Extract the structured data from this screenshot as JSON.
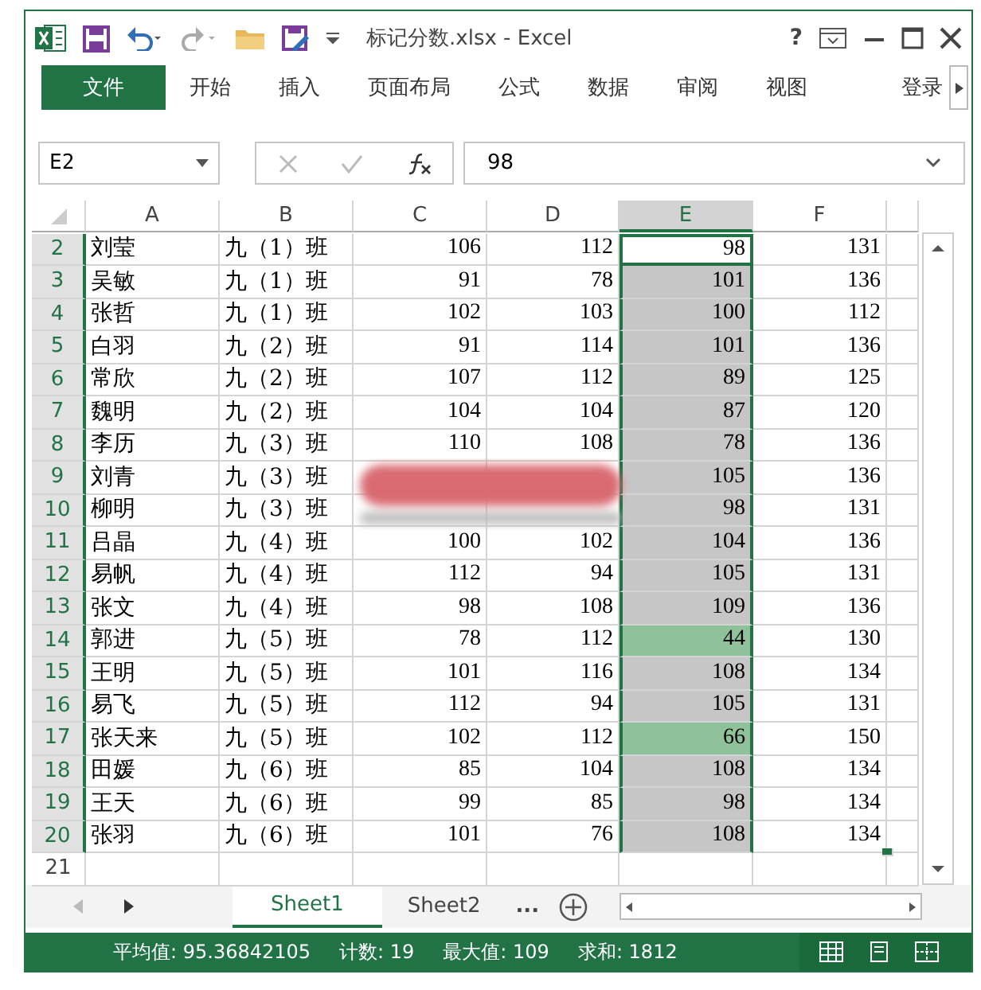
{
  "window": {
    "title": "标记分数.xlsx - Excel",
    "help": "?"
  },
  "ribbon_tabs": [
    {
      "label": "文件",
      "kind": "file"
    },
    {
      "label": "开始",
      "kind": "tab"
    },
    {
      "label": "插入",
      "kind": "tab"
    },
    {
      "label": "页面布局",
      "kind": "tab"
    },
    {
      "label": "公式",
      "kind": "tab"
    },
    {
      "label": "数据",
      "kind": "tab"
    },
    {
      "label": "审阅",
      "kind": "tab"
    },
    {
      "label": "视图",
      "kind": "tab"
    },
    {
      "label": "登录",
      "kind": "account"
    }
  ],
  "name_box": {
    "value": "E2"
  },
  "formula_bar": {
    "value": "98"
  },
  "columns": [
    {
      "label": "A",
      "selected": false
    },
    {
      "label": "B",
      "selected": false
    },
    {
      "label": "C",
      "selected": false
    },
    {
      "label": "D",
      "selected": false
    },
    {
      "label": "E",
      "selected": true
    },
    {
      "label": "F",
      "selected": false
    }
  ],
  "rows": [
    {
      "number": "2",
      "selected": true,
      "cells": [
        "刘莹",
        "九（1）班",
        "106",
        "112",
        "98",
        "131"
      ],
      "active": true
    },
    {
      "number": "3",
      "selected": true,
      "cells": [
        "吴敏",
        "九（1）班",
        "91",
        "78",
        "101",
        "136"
      ],
      "color": "#c6c6c6"
    },
    {
      "number": "4",
      "selected": true,
      "cells": [
        "张哲",
        "九（1）班",
        "102",
        "103",
        "100",
        "112"
      ],
      "color": "#c6c6c6"
    },
    {
      "number": "5",
      "selected": true,
      "cells": [
        "白羽",
        "九（2）班",
        "91",
        "114",
        "101",
        "136"
      ],
      "color": "#c6c6c6"
    },
    {
      "number": "6",
      "selected": true,
      "cells": [
        "常欣",
        "九（2）班",
        "107",
        "112",
        "89",
        "125"
      ],
      "color": "#c6c6c6"
    },
    {
      "number": "7",
      "selected": true,
      "cells": [
        "魏明",
        "九（2）班",
        "104",
        "104",
        "87",
        "120"
      ],
      "color": "#c6c6c6"
    },
    {
      "number": "8",
      "selected": true,
      "cells": [
        "李历",
        "九（3）班",
        "110",
        "108",
        "78",
        "136"
      ],
      "color": "#c6c6c6"
    },
    {
      "number": "9",
      "selected": true,
      "cells": [
        "刘青",
        "九（3）班",
        null,
        null,
        "105",
        "136"
      ],
      "color": "#c6c6c6"
    },
    {
      "number": "10",
      "selected": true,
      "cells": [
        "柳明",
        "九（3）班",
        null,
        null,
        "98",
        "131"
      ],
      "color": "#c6c6c6"
    },
    {
      "number": "11",
      "selected": true,
      "cells": [
        "吕晶",
        "九（4）班",
        "100",
        "102",
        "104",
        "136"
      ],
      "color": "#c6c6c6"
    },
    {
      "number": "12",
      "selected": true,
      "cells": [
        "易帆",
        "九（4）班",
        "112",
        "94",
        "105",
        "131"
      ],
      "color": "#c6c6c6"
    },
    {
      "number": "13",
      "selected": true,
      "cells": [
        "张文",
        "九（4）班",
        "98",
        "108",
        "109",
        "136"
      ],
      "color": "#c6c6c6"
    },
    {
      "number": "14",
      "selected": true,
      "cells": [
        "郭进",
        "九（5）班",
        "78",
        "112",
        "44",
        "130"
      ],
      "color": "#8fc29b"
    },
    {
      "number": "15",
      "selected": true,
      "cells": [
        "王明",
        "九（5）班",
        "101",
        "116",
        "108",
        "134"
      ],
      "color": "#c6c6c6"
    },
    {
      "number": "16",
      "selected": true,
      "cells": [
        "易飞",
        "九（5）班",
        "112",
        "94",
        "105",
        "131"
      ],
      "color": "#c6c6c6"
    },
    {
      "number": "17",
      "selected": true,
      "cells": [
        "张天来",
        "九（5）班",
        "102",
        "112",
        "66",
        "150"
      ],
      "color": "#8fc29b"
    },
    {
      "number": "18",
      "selected": true,
      "cells": [
        "田媛",
        "九（6）班",
        "85",
        "104",
        "108",
        "134"
      ],
      "color": "#c6c6c6"
    },
    {
      "number": "19",
      "selected": true,
      "cells": [
        "王天",
        "九（6）班",
        "99",
        "85",
        "98",
        "134"
      ],
      "color": "#c6c6c6"
    },
    {
      "number": "20",
      "selected": true,
      "cells": [
        "张羽",
        "九（6）班",
        "101",
        "76",
        "108",
        "134"
      ],
      "color": "#c6c6c6"
    },
    {
      "number": "21",
      "selected": false,
      "cells": []
    }
  ],
  "sheet_tabs": [
    {
      "label": "Sheet1",
      "selected": true
    },
    {
      "label": "Sheet2",
      "selected": false
    }
  ],
  "more_sheets": "...",
  "status_bar": [
    "平均值: 95.36842105",
    "计数: 19",
    "最大值: 109",
    "求和: 1812"
  ]
}
